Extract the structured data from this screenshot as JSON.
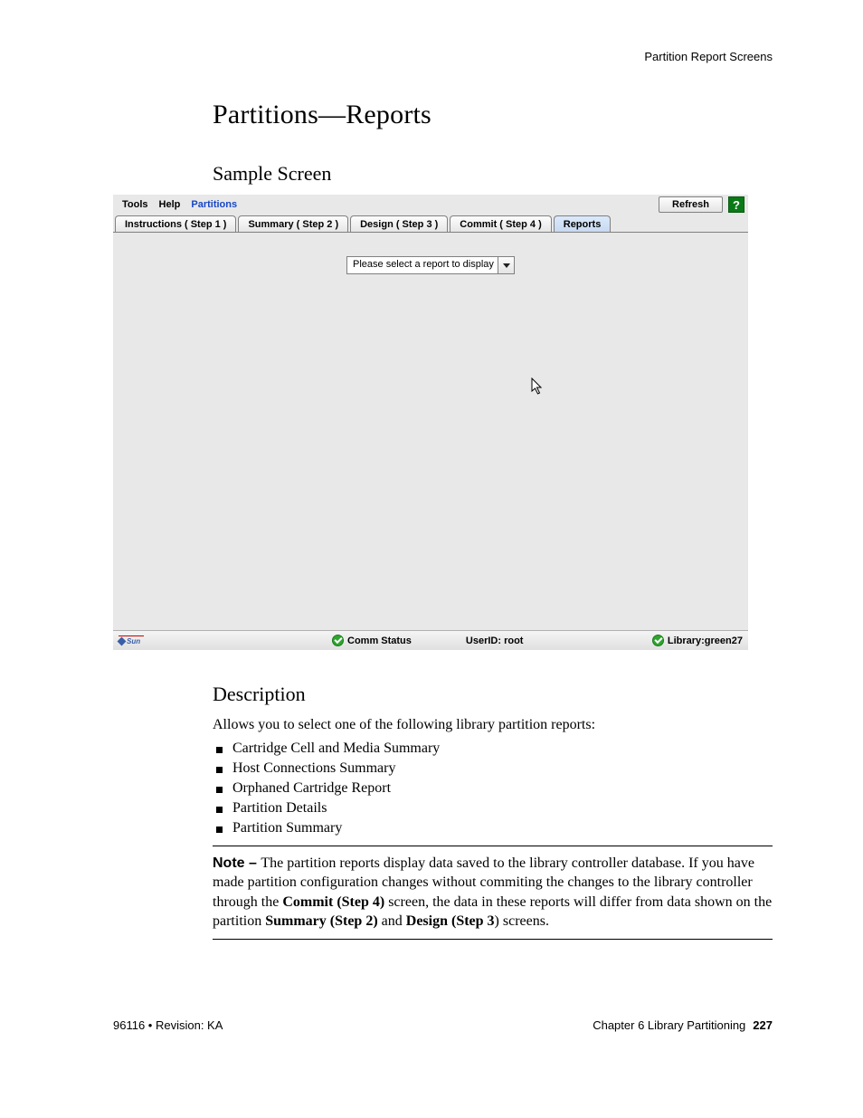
{
  "header": {
    "right": "Partition Report Screens"
  },
  "title": "Partitions—Reports",
  "sample_heading": "Sample Screen",
  "app": {
    "menubar": {
      "tools": "Tools",
      "help": "Help",
      "partitions": "Partitions"
    },
    "refresh": "Refresh",
    "help_btn": "?",
    "tabs": {
      "t1": "Instructions ( Step 1 )",
      "t2": "Summary ( Step 2 )",
      "t3": "Design ( Step 3 )",
      "t4": "Commit ( Step 4 )",
      "t5": "Reports"
    },
    "dropdown_text": "Please select a report to display",
    "status": {
      "comm": "Comm Status",
      "user": "UserID: root",
      "library": "Library:green27",
      "sun": "Sun"
    }
  },
  "description_heading": "Description",
  "desc_intro": "Allows you to select one of the following library partition reports:",
  "bullets": {
    "b1": "Cartridge Cell and Media Summary",
    "b2": "Host Connections Summary",
    "b3": "Orphaned Cartridge Report",
    "b4": "Partition Details",
    "b5": "Partition Summary"
  },
  "note": {
    "label": "Note – ",
    "part1": "The partition reports display data saved to the library controller database. If you have made partition configuration changes without commiting the changes to the library controller through the ",
    "commit": "Commit (Step 4)",
    "part2": " screen, the data in these reports will differ from data shown on the partition ",
    "summary": "Summary (Step 2)",
    "and": " and ",
    "design": "Design (Step 3",
    "part3": ") screens."
  },
  "footer": {
    "left": "96116 • Revision: KA",
    "chapter": "Chapter 6 Library Partitioning",
    "page": "227"
  }
}
